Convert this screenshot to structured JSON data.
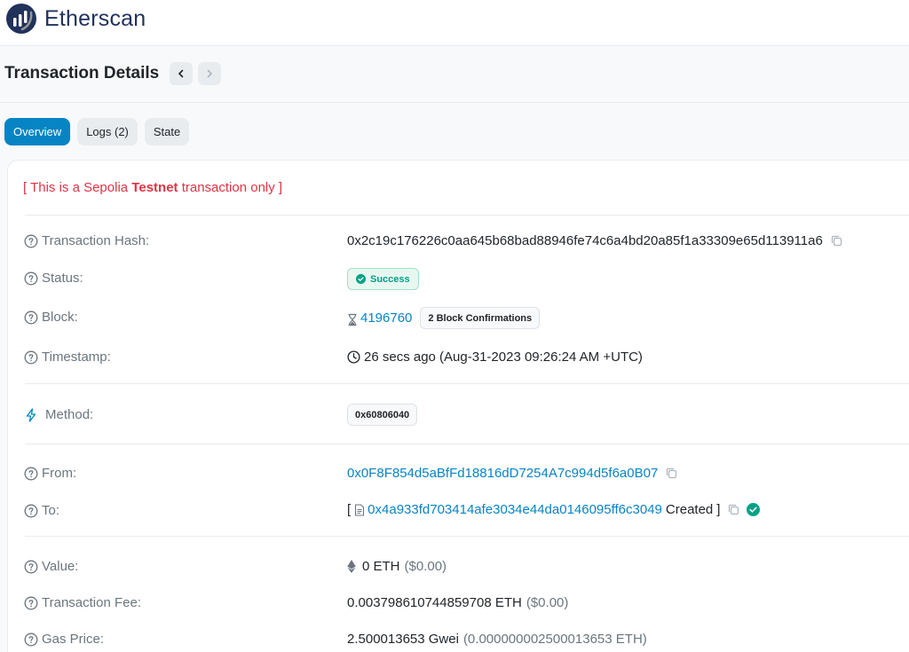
{
  "header": {
    "logo_text": "Etherscan"
  },
  "page": {
    "title": "Transaction Details"
  },
  "tabs": [
    "Overview",
    "Logs (2)",
    "State"
  ],
  "notice": {
    "prefix": "[ This is a Sepolia ",
    "bold": "Testnet",
    "suffix": " transaction only ]"
  },
  "rows": {
    "hash": {
      "label": "Transaction Hash:",
      "value": "0x2c19c176226c0aa645b68bad88946fe74c6a4bd20a85f1a33309e65d113911a6"
    },
    "status": {
      "label": "Status:",
      "value": "Success"
    },
    "block": {
      "label": "Block:",
      "value": "4196760",
      "confirmations": "2 Block Confirmations"
    },
    "timestamp": {
      "label": "Timestamp:",
      "value": "26 secs ago (Aug-31-2023 09:26:24 AM +UTC)"
    },
    "method": {
      "label": "Method:",
      "value": "0x60806040"
    },
    "from": {
      "label": "From:",
      "value": "0x0F8F854d5aBfFd18816dD7254A7c994d5f6a0B07"
    },
    "to": {
      "label": "To:",
      "open": "[",
      "value": "0x4a933fd703414afe3034e44da0146095ff6c3049",
      "created": "Created",
      "close": "]"
    },
    "value": {
      "label": "Value:",
      "value": "0 ETH",
      "usd": "($0.00)"
    },
    "fee": {
      "label": "Transaction Fee:",
      "value": "0.003798610744859708 ETH",
      "usd": "($0.00)"
    },
    "gas": {
      "label": "Gas Price:",
      "value": "2.500013653 Gwei",
      "eth": "(0.000000002500013653 ETH)"
    }
  },
  "colors": {
    "accent": "#0784c3",
    "success": "#00a186",
    "danger": "#dc3545",
    "brand": "#21325b"
  },
  "icons": [
    "etherscan-logo",
    "chevron-left-icon",
    "chevron-right-icon",
    "question-circle-icon",
    "check-circle-icon",
    "hourglass-icon",
    "clock-icon",
    "bolt-icon",
    "copy-icon",
    "file-icon",
    "eth-icon"
  ]
}
